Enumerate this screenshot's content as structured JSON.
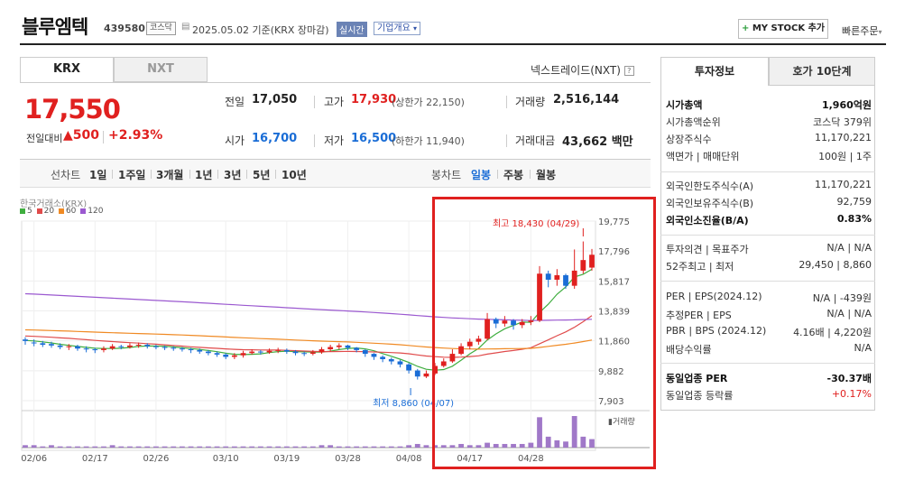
{
  "header": {
    "name": "블루엠텍",
    "code": "439580",
    "market_badge": "코스닥",
    "date": "2025.05.02 기준(KRX 장마감)",
    "live_label": "실시간",
    "overview_label": "기업개요",
    "mystock_label": "MY STOCK 추가",
    "quick_order": "빠른주문"
  },
  "tabs": {
    "krx": "KRX",
    "nxt": "NXT",
    "nxt_link": "넥스트레이드(NXT)"
  },
  "quote": {
    "price": "17,550",
    "change_label": "전일대비",
    "change_value": "500",
    "change_pct": "+2.93%",
    "prev_label": "전일",
    "prev_value": "17,050",
    "high_label": "고가",
    "high_value": "17,930",
    "upper_limit": "(상한가 22,150)",
    "volume_label": "거래량",
    "volume_value": "2,516,144",
    "open_label": "시가",
    "open_value": "16,700",
    "low_label": "저가",
    "low_value": "16,500",
    "lower_limit": "(하한가 11,940)",
    "amount_label": "거래대금",
    "amount_value": "43,662",
    "amount_unit": "백만"
  },
  "ranges": {
    "label": "선차트",
    "items": [
      "1일",
      "1주일",
      "3개월",
      "1년",
      "3년",
      "5년",
      "10년"
    ],
    "candle_label": "봉차트",
    "candle_items": [
      "일봉",
      "주봉",
      "월봉"
    ]
  },
  "chart_data": {
    "type": "candlestick",
    "source": "한국거래소(KRX)",
    "legend": [
      {
        "name": "5",
        "color": "#3fae3f"
      },
      {
        "name": "20",
        "color": "#e04b4b"
      },
      {
        "name": "60",
        "color": "#f08a24"
      },
      {
        "name": "120",
        "color": "#9b59d0"
      }
    ],
    "y_ticks": [
      "19,775",
      "17,796",
      "15,817",
      "13,839",
      "11,860",
      "9,882",
      "7,903"
    ],
    "ylim": [
      7903,
      19775
    ],
    "x_ticks": [
      "02/06",
      "02/17",
      "02/26",
      "03/10",
      "03/19",
      "03/28",
      "04/08",
      "04/17",
      "04/28"
    ],
    "high_annotation": "최고 18,430 (04/29)",
    "low_annotation": "최저 8,860 (04/07)",
    "volume_label": "거래량",
    "candles": [
      [
        11950,
        11850,
        12100,
        11600
      ],
      [
        11750,
        11700,
        11950,
        11500
      ],
      [
        11700,
        11600,
        11850,
        11450
      ],
      [
        11650,
        11550,
        11800,
        11400
      ],
      [
        11550,
        11450,
        11700,
        11300
      ],
      [
        11450,
        11500,
        11650,
        11250
      ],
      [
        11500,
        11350,
        11600,
        11200
      ],
      [
        11350,
        11300,
        11500,
        11100
      ],
      [
        11300,
        11250,
        11400,
        11050
      ],
      [
        11250,
        11350,
        11500,
        11100
      ],
      [
        11350,
        11500,
        11650,
        11250
      ],
      [
        11500,
        11450,
        11600,
        11300
      ],
      [
        11450,
        11550,
        11700,
        11350
      ],
      [
        11550,
        11600,
        11750,
        11400
      ],
      [
        11600,
        11500,
        11700,
        11350
      ],
      [
        11500,
        11450,
        11600,
        11300
      ],
      [
        11450,
        11400,
        11550,
        11250
      ],
      [
        11400,
        11350,
        11500,
        11200
      ],
      [
        11350,
        11300,
        11450,
        11150
      ],
      [
        11300,
        11250,
        11400,
        11050
      ],
      [
        11250,
        11150,
        11350,
        11000
      ],
      [
        11150,
        11050,
        11250,
        10900
      ],
      [
        11050,
        10950,
        11150,
        10800
      ],
      [
        10950,
        10800,
        11050,
        10650
      ],
      [
        10800,
        10900,
        11050,
        10650
      ],
      [
        10900,
        11050,
        11200,
        10750
      ],
      [
        11050,
        11150,
        11300,
        10950
      ],
      [
        11150,
        11100,
        11250,
        10950
      ],
      [
        11100,
        11200,
        11350,
        11000
      ],
      [
        11200,
        11250,
        11400,
        11050
      ],
      [
        11250,
        11150,
        11350,
        11000
      ],
      [
        11150,
        11050,
        11250,
        10900
      ],
      [
        11050,
        11000,
        11150,
        10850
      ],
      [
        11000,
        11100,
        11250,
        10900
      ],
      [
        11100,
        11300,
        11450,
        11000
      ],
      [
        11300,
        11450,
        11600,
        11150
      ],
      [
        11450,
        11550,
        11700,
        11300
      ],
      [
        11550,
        11400,
        11600,
        11250
      ],
      [
        11400,
        11250,
        11450,
        11100
      ],
      [
        11250,
        11000,
        11300,
        10800
      ],
      [
        11000,
        10800,
        11050,
        10600
      ],
      [
        10800,
        10650,
        10900,
        10450
      ],
      [
        10650,
        10500,
        10750,
        10300
      ],
      [
        10500,
        10300,
        10600,
        10100
      ],
      [
        10300,
        9900,
        10400,
        9700
      ],
      [
        9900,
        9500,
        10000,
        9300
      ],
      [
        9500,
        9700,
        9900,
        9400
      ],
      [
        9700,
        10200,
        10400,
        9600
      ],
      [
        10200,
        10500,
        10700,
        10100
      ],
      [
        10500,
        11000,
        11300,
        10400
      ],
      [
        11000,
        11500,
        11700,
        10900
      ],
      [
        11500,
        11800,
        12000,
        11300
      ],
      [
        11800,
        12000,
        12200,
        11600
      ],
      [
        12000,
        13300,
        13700,
        11900
      ],
      [
        13300,
        13000,
        13400,
        12700
      ],
      [
        13000,
        13200,
        13500,
        12800
      ],
      [
        13200,
        12900,
        13300,
        12600
      ],
      [
        12900,
        13100,
        13300,
        12700
      ],
      [
        13100,
        13200,
        13500,
        12900
      ],
      [
        13200,
        16300,
        16800,
        13100
      ],
      [
        16300,
        15900,
        16500,
        15400
      ],
      [
        15900,
        16200,
        16600,
        15500
      ],
      [
        16200,
        15500,
        16300,
        15300
      ],
      [
        15500,
        16500,
        17900,
        15300
      ],
      [
        16500,
        17200,
        18430,
        16300
      ],
      [
        16700,
        17550,
        17930,
        16500
      ]
    ],
    "volume": [
      2,
      2,
      1,
      2,
      1,
      1,
      1,
      1,
      1,
      1,
      2,
      1,
      1,
      1,
      1,
      1,
      1,
      1,
      1,
      1,
      1,
      1,
      1,
      1,
      1,
      1,
      1,
      1,
      1,
      1,
      1,
      1,
      1,
      1,
      2,
      2,
      1,
      1,
      1,
      1,
      1,
      1,
      1,
      1,
      2,
      3,
      2,
      2,
      2,
      2,
      3,
      2,
      2,
      4,
      3,
      3,
      3,
      3,
      4,
      25,
      9,
      6,
      5,
      26,
      9,
      7
    ]
  },
  "right": {
    "tab_invest": "투자정보",
    "tab_quote": "호가 10단계",
    "rows1": [
      {
        "label": "시가총액",
        "value": "1,960억원",
        "bold": true
      },
      {
        "label": "시가총액순위",
        "value": "코스닥 379위"
      },
      {
        "label": "상장주식수",
        "value": "11,170,221"
      },
      {
        "label": "액면가 | 매매단위",
        "value": "100원 | 1주"
      }
    ],
    "rows2": [
      {
        "label": "외국인한도주식수(A)",
        "value": "11,170,221"
      },
      {
        "label": "외국인보유주식수(B)",
        "value": "92,759"
      },
      {
        "label": "외국인소진율(B/A)",
        "value": "0.83%",
        "bold": true
      }
    ],
    "rows3": [
      {
        "label": "투자의견 | 목표주가",
        "value": "N/A | N/A"
      },
      {
        "label": "52주최고 | 최저",
        "value": "29,450 | 8,860"
      }
    ],
    "rows4": [
      {
        "label": "PER | EPS(2024.12)",
        "value": "N/A | -439원"
      },
      {
        "label": "추정PER | EPS",
        "value": "N/A | N/A"
      },
      {
        "label": "PBR | BPS (2024.12)",
        "value": "4.16배 | 4,220원"
      },
      {
        "label": "배당수익률",
        "value": "N/A"
      }
    ],
    "rows5": [
      {
        "label": "동일업종 PER",
        "value": "-30.37배",
        "bold": true
      },
      {
        "label": "동일업종 등락률",
        "value": "+0.17%",
        "red": true
      }
    ]
  }
}
